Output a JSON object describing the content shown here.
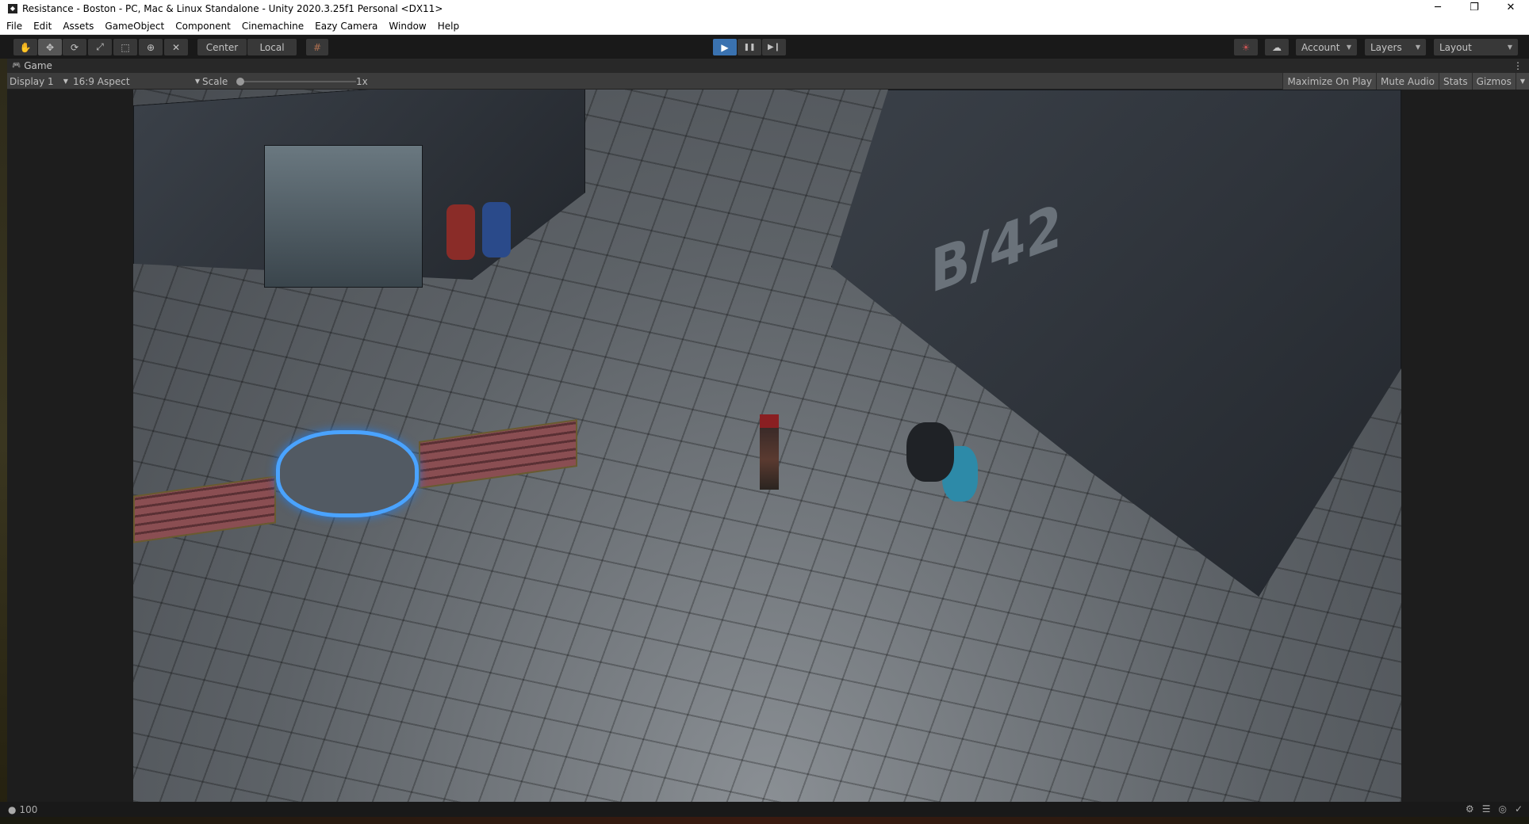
{
  "window": {
    "title": "Resistance - Boston - PC, Mac & Linux Standalone - Unity 2020.3.25f1 Personal <DX11>",
    "minimize": "─",
    "restore": "❐",
    "close": "✕"
  },
  "menu": [
    "File",
    "Edit",
    "Assets",
    "GameObject",
    "Component",
    "Cinemachine",
    "Eazy Camera",
    "Window",
    "Help"
  ],
  "toolbar": {
    "tools": [
      {
        "name": "hand-tool",
        "glyph": "✋"
      },
      {
        "name": "move-tool",
        "glyph": "✥"
      },
      {
        "name": "rotate-tool",
        "glyph": "⟳"
      },
      {
        "name": "scale-tool",
        "glyph": "⤢"
      },
      {
        "name": "rect-tool",
        "glyph": "⬚"
      },
      {
        "name": "transform-tool",
        "glyph": "⊕"
      },
      {
        "name": "custom-tool",
        "glyph": "✕"
      }
    ],
    "pivot": "Center",
    "space": "Local",
    "snap": "#",
    "play": "▶",
    "pause": "❚❚",
    "step": "▶❙",
    "collab": "☀",
    "cloud": "☁",
    "account": "Account",
    "layers": "Layers",
    "layout": "Layout",
    "dropdown": "▼"
  },
  "game": {
    "tab": "Game",
    "tab_icon": "🎮",
    "more": "⋮",
    "display": "Display 1",
    "aspect": "16:9 Aspect",
    "scale_label": "Scale",
    "scale_value": "1x",
    "scale_fraction": 0,
    "maximize": "Maximize On Play",
    "mute": "Mute Audio",
    "stats": "Stats",
    "gizmos": "Gizmos",
    "scene_sign": "B/42"
  },
  "status": {
    "count": "100",
    "icons": [
      "⚙",
      "☰",
      "◎",
      "✓"
    ]
  }
}
